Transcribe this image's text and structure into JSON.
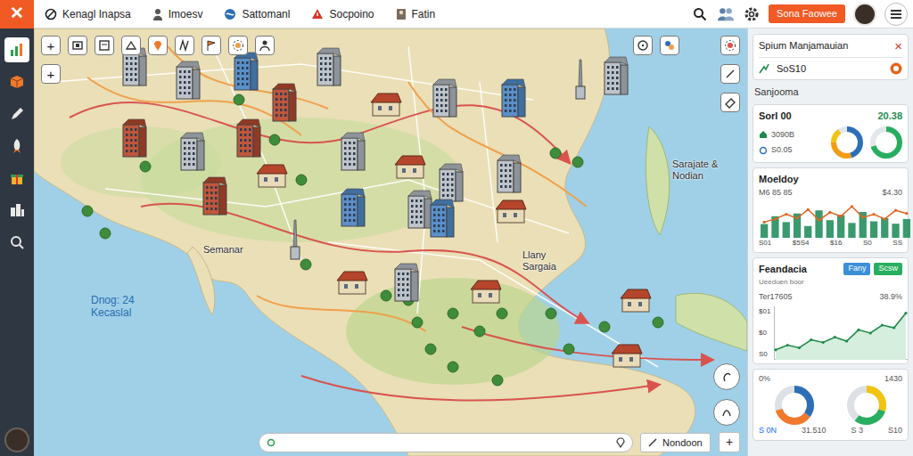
{
  "app": {
    "close_icon": "✕"
  },
  "tabs": [
    {
      "label": "Kenagl Inapsa"
    },
    {
      "label": "Imoesv"
    },
    {
      "label": "Sattomanl"
    },
    {
      "label": "Socpoino"
    },
    {
      "label": "Fatin"
    }
  ],
  "topbar": {
    "button": "Sona Faowee"
  },
  "sidebar": {
    "items": [
      {
        "selected": true
      },
      {
        "selected": false
      },
      {
        "selected": false
      },
      {
        "selected": false
      },
      {
        "selected": false
      },
      {
        "selected": false
      },
      {
        "selected": false
      }
    ]
  },
  "map": {
    "zoom_buttons": [
      "+",
      "+"
    ],
    "labels": [
      {
        "lines": [
          "Semanar"
        ],
        "kind": "plain"
      },
      {
        "lines": [
          "Dnog: 24",
          "Kecaslal"
        ],
        "kind": "region"
      },
      {
        "lines": [
          "Llany",
          "Sargaia"
        ],
        "kind": "plain"
      },
      {
        "lines": [
          "Sarajate &",
          "Nodian"
        ],
        "kind": "plain"
      }
    ],
    "search": {
      "button": "Nondoon",
      "add": "+"
    }
  },
  "panel": {
    "title": "Spium Manjamauian",
    "close": "×",
    "summary": "SoS10",
    "section": "Sanjooma",
    "stats": {
      "title": "Sorl 00",
      "value": "20.38",
      "rows": [
        "3090B",
        "S0.05"
      ],
      "donuts": [
        {
          "segments": [
            {
              "level": 0.45,
              "color": "#2c6fb7"
            },
            {
              "level": 0.3,
              "color": "#f39c12"
            },
            {
              "level": 0.15,
              "color": "#f1c40f"
            }
          ]
        },
        {
          "segments": [
            {
              "level": 0.7,
              "color": "#27ae60"
            }
          ]
        }
      ]
    },
    "activity": {
      "title": "Moeldoy",
      "subtitle": "M6 85 85",
      "value": "$4.30",
      "bars": [
        35,
        55,
        40,
        62,
        30,
        70,
        45,
        58,
        38,
        66,
        42,
        50,
        36,
        48
      ],
      "line": [
        40,
        48,
        60,
        50,
        72,
        45,
        65,
        55,
        80,
        52,
        60,
        48,
        70,
        62
      ],
      "x_ticks": [
        "S01",
        "$5S4",
        "$16",
        "S0",
        "SS"
      ]
    },
    "trend": {
      "title": "Feandacia",
      "subtitle": "Ueeduen boor",
      "buttons": [
        {
          "label": "Fany",
          "color": "#3b8fd9"
        },
        {
          "label": "Scsw",
          "color": "#27ae60"
        }
      ],
      "metric": "Ter17605",
      "change": "38.9%",
      "y_ticks": [
        "$01",
        "$0",
        "S0"
      ],
      "values": [
        15,
        22,
        18,
        30,
        26,
        34,
        28,
        45,
        40,
        52,
        48,
        70
      ]
    },
    "gauges": {
      "labels": [
        "0%",
        "1430"
      ],
      "footer": [
        "S 0N",
        "31.510",
        "S 3",
        "S10"
      ],
      "dials": [
        {
          "segments": [
            {
              "level": 0.35,
              "color": "#2c6fb7"
            },
            {
              "level": 0.35,
              "color": "#f0792b"
            }
          ]
        },
        {
          "segments": [
            {
              "level": 0.3,
              "color": "#f1c40f"
            },
            {
              "level": 0.3,
              "color": "#27ae60"
            }
          ]
        }
      ]
    }
  }
}
